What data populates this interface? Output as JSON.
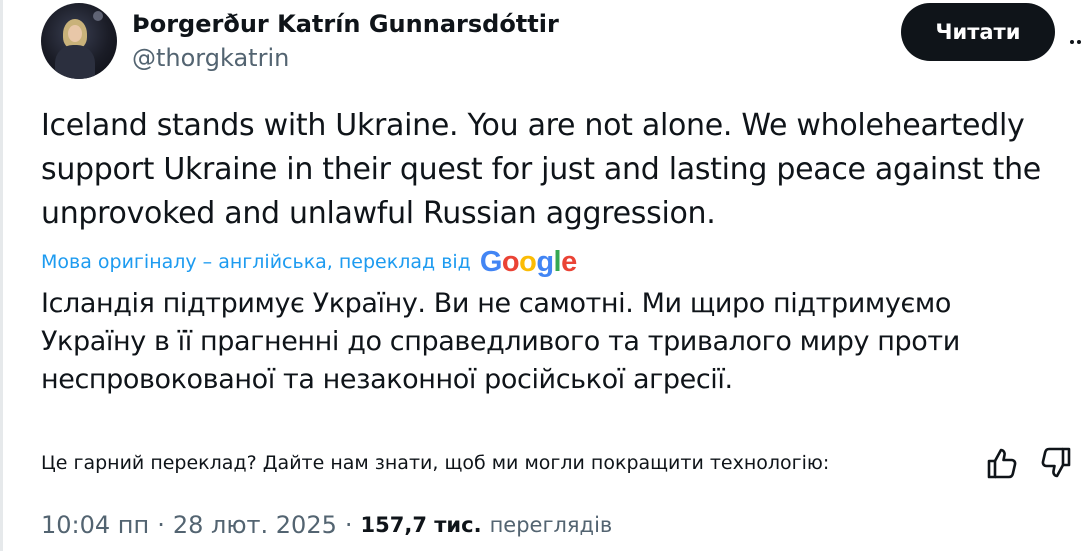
{
  "author": {
    "display_name": "Þorgerður Katrín Gunnarsdóttir",
    "handle": "@thorgkatrin"
  },
  "follow_button_label": "Читати",
  "tweet": {
    "original_text": "Iceland stands with Ukraine. You are not alone. We wholeheartedly support Ukraine in their quest for just and lasting peace against the unprovoked and unlawful Russian aggression.",
    "translation_note": "Мова оригіналу – англійська, переклад від",
    "translation_provider": "Google",
    "translated_text": "Ісландія підтримує Україну. Ви не самотні. Ми щиро підтримуємо Україну в її прагненні до справедливого та тривалого миру проти неспровокованої та незаконної російської агресії."
  },
  "feedback": {
    "prompt": "Це гарний переклад? Дайте нам знати, щоб ми могли покращити технологію:"
  },
  "meta": {
    "time": "10:04 пп",
    "separator": "·",
    "date": "28 лют. 2025",
    "views_count": "157,7 тис.",
    "views_label": "переглядів"
  },
  "colors": {
    "text": "#0f1419",
    "secondary": "#536471",
    "link": "#1d9bf0",
    "button": "#0f1419"
  },
  "icons": [
    "thumbs-up-icon",
    "thumbs-down-icon",
    "more-icon",
    "google-logo"
  ]
}
